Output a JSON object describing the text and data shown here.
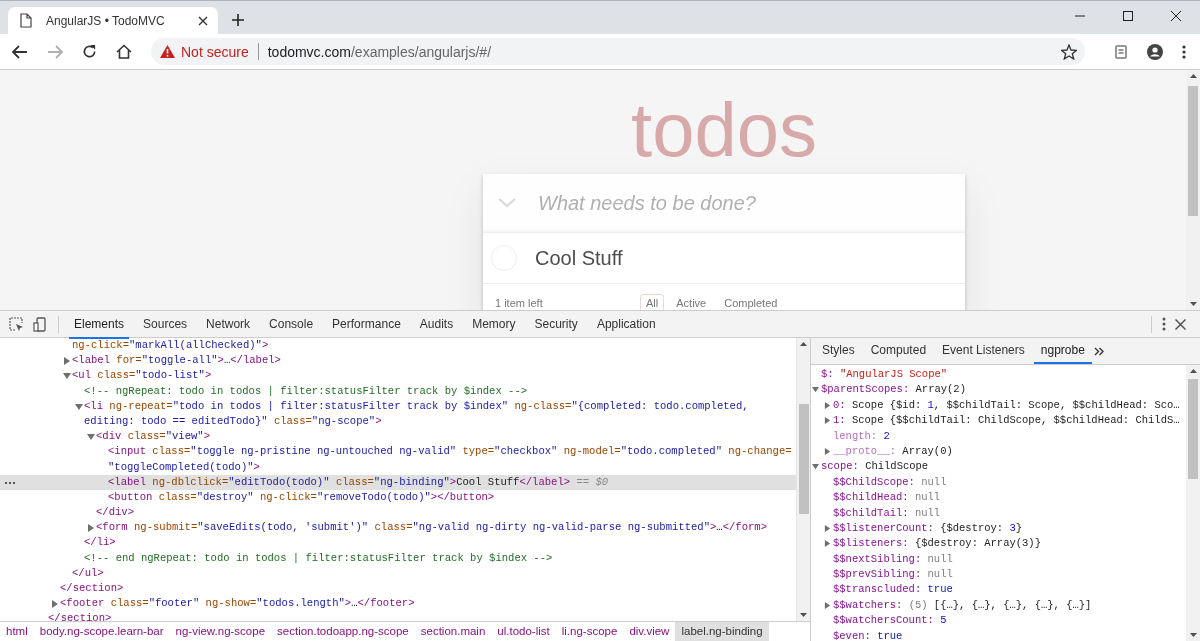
{
  "browser_tab": {
    "title": "AngularJS • TodoMVC"
  },
  "address_bar": {
    "security": "Not secure",
    "host": "todomvc.com",
    "path": "/examples/angularjs/#/",
    "forward_disabled": true
  },
  "page": {
    "heading": "todos",
    "new_todo_placeholder": "What needs to be done?",
    "todos": [
      {
        "title": "Cool Stuff",
        "completed": false
      }
    ],
    "footer": {
      "count": "1 item left",
      "filters": [
        {
          "label": "All",
          "selected": true
        },
        {
          "label": "Active",
          "selected": false
        },
        {
          "label": "Completed",
          "selected": false
        }
      ]
    }
  },
  "devtools": {
    "tabs": [
      {
        "label": "Elements",
        "selected": true
      },
      {
        "label": "Sources",
        "selected": false
      },
      {
        "label": "Network",
        "selected": false
      },
      {
        "label": "Console",
        "selected": false
      },
      {
        "label": "Performance",
        "selected": false
      },
      {
        "label": "Audits",
        "selected": false
      },
      {
        "label": "Memory",
        "selected": false
      },
      {
        "label": "Security",
        "selected": false
      },
      {
        "label": "Application",
        "selected": false
      }
    ],
    "dom_tree": [
      {
        "children": [
          {
            "children": [
              {
                "selected": false,
                "lines": [
                  [
                    {
                      "kind": "attr",
                      "text": "ng-click="
                    },
                    {
                      "kind": "value",
                      "text": "\"markAll(allChecked)\""
                    },
                    {
                      "kind": "tag",
                      "text": ">"
                    }
                  ]
                ]
              },
              {
                "selected": false,
                "expanded": false,
                "lines": [
                  [
                    {
                      "kind": "tag",
                      "text": "<label"
                    },
                    {
                      "kind": "attr",
                      "text": " for="
                    },
                    {
                      "kind": "value",
                      "text": "\"toggle-all\""
                    },
                    {
                      "kind": "tag",
                      "text": ">"
                    },
                    {
                      "kind": "text",
                      "text": "…"
                    },
                    {
                      "kind": "tag",
                      "text": "</label>"
                    }
                  ]
                ]
              },
              {
                "selected": false,
                "expanded": true,
                "lines": [
                  [
                    {
                      "kind": "tag",
                      "text": "<ul"
                    },
                    {
                      "kind": "attr",
                      "text": " class="
                    },
                    {
                      "kind": "value",
                      "text": "\"todo-list\""
                    },
                    {
                      "kind": "tag",
                      "text": ">"
                    }
                  ]
                ],
                "children": [
                  {
                    "selected": false,
                    "lines": [
                      [
                        {
                          "kind": "comment",
                          "text": "<!-- ngRepeat: todo in todos | filter:statusFilter track by $index -->"
                        }
                      ]
                    ]
                  },
                  {
                    "selected": false,
                    "expanded": true,
                    "lines": [
                      [
                        {
                          "kind": "tag",
                          "text": "<li"
                        },
                        {
                          "kind": "attr",
                          "text": " ng-repeat="
                        },
                        {
                          "kind": "value",
                          "text": "\"todo in todos | filter:statusFilter track by $index\""
                        },
                        {
                          "kind": "attr",
                          "text": " ng-class="
                        },
                        {
                          "kind": "value",
                          "text": "\"{completed: todo.completed,"
                        }
                      ],
                      [
                        {
                          "kind": "value",
                          "text": "editing: todo == editedTodo}\""
                        },
                        {
                          "kind": "attr",
                          "text": " class="
                        },
                        {
                          "kind": "value",
                          "text": "\"ng-scope\""
                        },
                        {
                          "kind": "tag",
                          "text": ">"
                        }
                      ]
                    ],
                    "children": [
                      {
                        "selected": false,
                        "expanded": true,
                        "lines": [
                          [
                            {
                              "kind": "tag",
                              "text": "<div"
                            },
                            {
                              "kind": "attr",
                              "text": " class="
                            },
                            {
                              "kind": "value",
                              "text": "\"view\""
                            },
                            {
                              "kind": "tag",
                              "text": ">"
                            }
                          ]
                        ],
                        "children": [
                          {
                            "selected": false,
                            "lines": [
                              [
                                {
                                  "kind": "tag",
                                  "text": "<input"
                                },
                                {
                                  "kind": "attr",
                                  "text": " class="
                                },
                                {
                                  "kind": "value",
                                  "text": "\"toggle ng-pristine ng-untouched ng-valid\""
                                },
                                {
                                  "kind": "attr",
                                  "text": " type="
                                },
                                {
                                  "kind": "value",
                                  "text": "\"checkbox\""
                                },
                                {
                                  "kind": "attr",
                                  "text": " ng-model="
                                },
                                {
                                  "kind": "value",
                                  "text": "\"todo.completed\""
                                },
                                {
                                  "kind": "attr",
                                  "text": " ng-change="
                                }
                              ],
                              [
                                {
                                  "kind": "value",
                                  "text": "\"toggleCompleted(todo)\""
                                },
                                {
                                  "kind": "tag",
                                  "text": ">"
                                }
                              ]
                            ]
                          },
                          {
                            "selected": true,
                            "lines": [
                              [
                                {
                                  "kind": "tag",
                                  "text": "<label"
                                },
                                {
                                  "kind": "attr",
                                  "text": " ng-dblclick="
                                },
                                {
                                  "kind": "value",
                                  "text": "\"editTodo(todo)\""
                                },
                                {
                                  "kind": "attr",
                                  "text": " class="
                                },
                                {
                                  "kind": "value",
                                  "text": "\"ng-binding\""
                                },
                                {
                                  "kind": "tag",
                                  "text": ">"
                                },
                                {
                                  "kind": "text",
                                  "text": "Cool Stuff"
                                },
                                {
                                  "kind": "tag",
                                  "text": "</label>"
                                },
                                {
                                  "kind": "hint",
                                  "text": " == $0"
                                }
                              ]
                            ]
                          },
                          {
                            "selected": false,
                            "lines": [
                              [
                                {
                                  "kind": "tag",
                                  "text": "<button"
                                },
                                {
                                  "kind": "attr",
                                  "text": " class="
                                },
                                {
                                  "kind": "value",
                                  "text": "\"destroy\""
                                },
                                {
                                  "kind": "attr",
                                  "text": " ng-click="
                                },
                                {
                                  "kind": "value",
                                  "text": "\"removeTodo(todo)\""
                                },
                                {
                                  "kind": "tag",
                                  "text": "></button>"
                                }
                              ]
                            ]
                          }
                        ],
                        "close": [
                          {
                            "kind": "tag",
                            "text": "</div>"
                          }
                        ]
                      },
                      {
                        "selected": false,
                        "expanded": false,
                        "lines": [
                          [
                            {
                              "kind": "tag",
                              "text": "<form"
                            },
                            {
                              "kind": "attr",
                              "text": " ng-submit="
                            },
                            {
                              "kind": "value",
                              "text": "\"saveEdits(todo, 'submit')\""
                            },
                            {
                              "kind": "attr",
                              "text": " class="
                            },
                            {
                              "kind": "value",
                              "text": "\"ng-valid ng-dirty ng-valid-parse ng-submitted\""
                            },
                            {
                              "kind": "tag",
                              "text": ">"
                            },
                            {
                              "kind": "text",
                              "text": "…"
                            },
                            {
                              "kind": "tag",
                              "text": "</form>"
                            }
                          ]
                        ]
                      }
                    ],
                    "close": [
                      {
                        "kind": "tag",
                        "text": "</li>"
                      }
                    ]
                  },
                  {
                    "selected": false,
                    "lines": [
                      [
                        {
                          "kind": "comment",
                          "text": "<!-- end ngRepeat: todo in todos | filter:statusFilter track by $index -->"
                        }
                      ]
                    ]
                  }
                ],
                "close": [
                  {
                    "kind": "tag",
                    "text": "</ul>"
                  }
                ]
              }
            ],
            "close": [
              {
                "kind": "tag",
                "text": "</section>"
              }
            ]
          },
          {
            "selected": false,
            "expanded": false,
            "lines": [
              [
                {
                  "kind": "tag",
                  "text": "<footer"
                },
                {
                  "kind": "attr",
                  "text": " class="
                },
                {
                  "kind": "value",
                  "text": "\"footer\""
                },
                {
                  "kind": "attr",
                  "text": " ng-show="
                },
                {
                  "kind": "value",
                  "text": "\"todos.length\""
                },
                {
                  "kind": "tag",
                  "text": ">"
                },
                {
                  "kind": "text",
                  "text": "…"
                },
                {
                  "kind": "tag",
                  "text": "</footer>"
                }
              ]
            ]
          }
        ],
        "close": [
          {
            "kind": "tag",
            "text": "</section>"
          }
        ]
      }
    ],
    "sidebar_tabs": [
      {
        "label": "Styles",
        "selected": false
      },
      {
        "label": "Computed",
        "selected": false
      },
      {
        "label": "Event Listeners",
        "selected": false
      },
      {
        "label": "ngprobe",
        "selected": true
      }
    ],
    "properties": [
      {
        "key": "$:",
        "value": [
          {
            "kind": "string",
            "text": "\"AngularJS Scope\""
          }
        ]
      },
      {
        "key": "$parentScopes:",
        "expanded": true,
        "value": [
          {
            "kind": "plain",
            "text": "Array(2)"
          }
        ],
        "children": [
          {
            "key": "0:",
            "expanded": false,
            "value": [
              {
                "kind": "plain",
                "text": "Scope {$id: "
              },
              {
                "kind": "number",
                "text": "1"
              },
              {
                "kind": "plain",
                "text": ", $$childTail: Scope, $$childHead: Sco…"
              }
            ]
          },
          {
            "key": "1:",
            "expanded": false,
            "value": [
              {
                "kind": "plain",
                "text": "Scope {$$childTail: ChildScope, $$childHead: ChildS…"
              }
            ]
          },
          {
            "key": "length:",
            "dim": true,
            "value": [
              {
                "kind": "number",
                "text": "2"
              }
            ]
          },
          {
            "key": "__proto__:",
            "dim": true,
            "expanded": false,
            "value": [
              {
                "kind": "plain",
                "text": "Array(0)"
              }
            ]
          }
        ]
      },
      {
        "key": "scope:",
        "expanded": true,
        "value": [
          {
            "kind": "plain",
            "text": "ChildScope"
          }
        ],
        "children": [
          {
            "key": "$$ChildScope:",
            "value": [
              {
                "kind": "null",
                "text": "null"
              }
            ]
          },
          {
            "key": "$$childHead:",
            "value": [
              {
                "kind": "null",
                "text": "null"
              }
            ]
          },
          {
            "key": "$$childTail:",
            "value": [
              {
                "kind": "null",
                "text": "null"
              }
            ]
          },
          {
            "key": "$$listenerCount:",
            "expanded": false,
            "value": [
              {
                "kind": "plain",
                "text": "{$destroy: "
              },
              {
                "kind": "number",
                "text": "3"
              },
              {
                "kind": "plain",
                "text": "}"
              }
            ]
          },
          {
            "key": "$$listeners:",
            "expanded": false,
            "value": [
              {
                "kind": "plain",
                "text": "{$destroy: Array(3)}"
              }
            ]
          },
          {
            "key": "$$nextSibling:",
            "value": [
              {
                "kind": "null",
                "text": "null"
              }
            ]
          },
          {
            "key": "$$prevSibling:",
            "value": [
              {
                "kind": "null",
                "text": "null"
              }
            ]
          },
          {
            "key": "$$transcluded:",
            "value": [
              {
                "kind": "bool",
                "text": "true"
              }
            ]
          },
          {
            "key": "$$watchers:",
            "expanded": false,
            "value": [
              {
                "kind": "null",
                "text": "(5) "
              },
              {
                "kind": "plain",
                "text": "[{…}, {…}, {…}, {…}, {…}]"
              }
            ]
          },
          {
            "key": "$$watchersCount:",
            "value": [
              {
                "kind": "number",
                "text": "5"
              }
            ]
          },
          {
            "key": "$even:",
            "value": [
              {
                "kind": "bool",
                "text": "true"
              }
            ]
          }
        ]
      }
    ],
    "breadcrumbs": [
      {
        "label": "html",
        "selected": false
      },
      {
        "label": "body.ng-scope.learn-bar",
        "selected": false
      },
      {
        "label": "ng-view.ng-scope",
        "selected": false
      },
      {
        "label": "section.todoapp.ng-scope",
        "selected": false
      },
      {
        "label": "section.main",
        "selected": false
      },
      {
        "label": "ul.todo-list",
        "selected": false
      },
      {
        "label": "li.ng-scope",
        "selected": false
      },
      {
        "label": "div.view",
        "selected": false
      },
      {
        "label": "label.ng-binding",
        "selected": true
      }
    ]
  }
}
